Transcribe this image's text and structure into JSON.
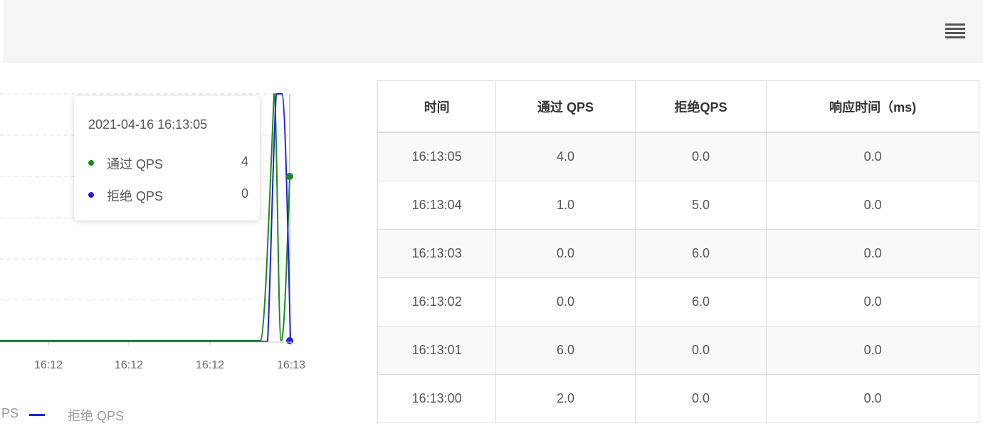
{
  "header": {
    "menu_icon": "hamburger-menu-icon"
  },
  "chart_data": {
    "type": "line",
    "x": [
      "16:12",
      "16:12",
      "16:12",
      "16:13"
    ],
    "series": [
      {
        "name": "通过 QPS",
        "color": "#1a8a1a"
      },
      {
        "name": "拒绝 QPS",
        "color": "#1f1fe0"
      }
    ],
    "grid": true,
    "legend": "bottom"
  },
  "chart": {
    "x_ticks": [
      "16:12",
      "16:12",
      "16:12",
      "16:13"
    ],
    "legend": {
      "pass_label_partial": "PS",
      "block_label": "拒绝 QPS"
    }
  },
  "tooltip": {
    "time": "2021-04-16 16:13:05",
    "items": [
      {
        "name": "通过 QPS",
        "value": "4",
        "color": "#1a8a1a"
      },
      {
        "name": "拒绝 QPS",
        "value": "0",
        "color": "#1f1fe0"
      }
    ]
  },
  "table": {
    "headers": [
      "时间",
      "通过 QPS",
      "拒绝QPS",
      "响应时间（ms)"
    ],
    "rows": [
      [
        "16:13:05",
        "4.0",
        "0.0",
        "0.0"
      ],
      [
        "16:13:04",
        "1.0",
        "5.0",
        "0.0"
      ],
      [
        "16:13:03",
        "0.0",
        "6.0",
        "0.0"
      ],
      [
        "16:13:02",
        "0.0",
        "6.0",
        "0.0"
      ],
      [
        "16:13:01",
        "6.0",
        "0.0",
        "0.0"
      ],
      [
        "16:13:00",
        "2.0",
        "0.0",
        "0.0"
      ]
    ]
  }
}
